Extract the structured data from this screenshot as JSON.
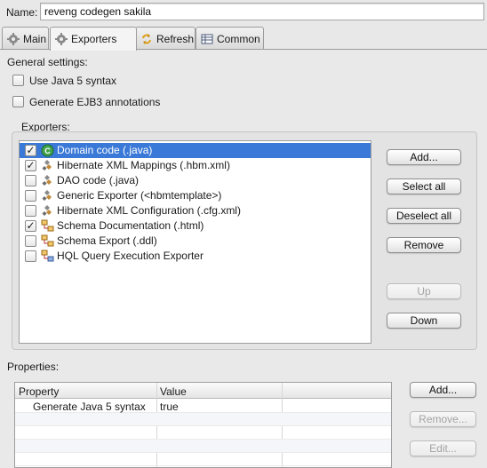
{
  "name": {
    "label": "Name:",
    "value": "reveng codegen sakila"
  },
  "tabs": [
    {
      "label": "Main",
      "icon": "gear-icon",
      "active": false
    },
    {
      "label": "Exporters",
      "icon": "gear-icon",
      "active": true
    },
    {
      "label": "Refresh",
      "icon": "refresh-icon",
      "active": false
    },
    {
      "label": "Common",
      "icon": "table-icon",
      "active": false
    }
  ],
  "general": {
    "title": "General settings:",
    "java5_label": "Use Java 5 syntax",
    "java5_checked": false,
    "ejb3_label": "Generate EJB3 annotations",
    "ejb3_checked": false
  },
  "exporters": {
    "title": "Exporters:",
    "items": [
      {
        "label": "Domain code (.java)",
        "checked": true,
        "selected": true,
        "icon": "java-class-icon"
      },
      {
        "label": "Hibernate XML Mappings (.hbm.xml)",
        "checked": true,
        "selected": false,
        "icon": "hibernate-icon"
      },
      {
        "label": "DAO code (.java)",
        "checked": false,
        "selected": false,
        "icon": "hibernate-icon"
      },
      {
        "label": "Generic Exporter (<hbmtemplate>)",
        "checked": false,
        "selected": false,
        "icon": "hibernate-icon"
      },
      {
        "label": "Hibernate XML Configuration (.cfg.xml)",
        "checked": false,
        "selected": false,
        "icon": "hibernate-icon"
      },
      {
        "label": "Schema Documentation (.html)",
        "checked": true,
        "selected": false,
        "icon": "schema-icon"
      },
      {
        "label": "Schema Export (.ddl)",
        "checked": false,
        "selected": false,
        "icon": "schema-icon"
      },
      {
        "label": "HQL Query Execution Exporter",
        "checked": false,
        "selected": false,
        "icon": "query-icon"
      }
    ],
    "buttons": {
      "add": "Add...",
      "select_all": "Select all",
      "deselect_all": "Deselect all",
      "remove": "Remove",
      "up": "Up",
      "down": "Down"
    }
  },
  "properties": {
    "title": "Properties:",
    "columns": [
      "Property",
      "Value"
    ],
    "rows": [
      {
        "property": "Generate Java 5 syntax",
        "value": "true"
      }
    ],
    "buttons": {
      "add": "Add...",
      "remove": "Remove...",
      "edit": "Edit..."
    }
  },
  "colors": {
    "selection": "#3a79d7",
    "panel": "#e9e9e9"
  }
}
